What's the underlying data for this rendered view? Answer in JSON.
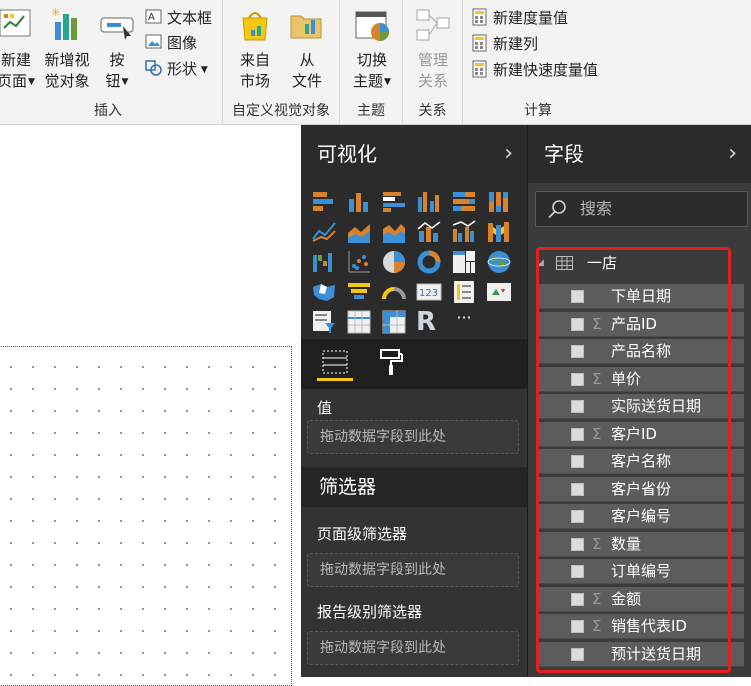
{
  "ribbon": {
    "insert": {
      "new_page": {
        "line1": "新建",
        "line2": "页面"
      },
      "new_visual": {
        "line1": "新增视",
        "line2": "觉对象"
      },
      "button": {
        "line1": "按",
        "line2": "钮"
      },
      "textbox": "文本框",
      "image": "图像",
      "shapes": "形状",
      "group_label": "插入"
    },
    "custom_visuals": {
      "from_market": {
        "line1": "来自",
        "line2": "市场"
      },
      "from_file": {
        "line1": "从",
        "line2": "文件"
      },
      "group_label": "自定义视觉对象"
    },
    "themes": {
      "switch_theme": {
        "line1": "切换",
        "line2": "主题"
      },
      "group_label": "主题"
    },
    "relationships": {
      "manage": {
        "line1": "管理",
        "line2": "关系"
      },
      "group_label": "关系"
    },
    "calculations": {
      "new_measure": "新建度量值",
      "new_column": "新建列",
      "new_quick_measure": "新建快速度量值",
      "group_label": "计算"
    }
  },
  "visualizations": {
    "title": "可视化",
    "more_label": "···",
    "r_label": "R",
    "kpi_text": "123",
    "values_well": {
      "title": "值",
      "placeholder": "拖动数据字段到此处"
    },
    "filters": {
      "title": "筛选器",
      "page_level": {
        "title": "页面级筛选器",
        "placeholder": "拖动数据字段到此处"
      },
      "report_level": {
        "title": "报告级别筛选器",
        "placeholder": "拖动数据字段到此处"
      }
    }
  },
  "fields": {
    "title": "字段",
    "search_placeholder": "搜索",
    "table_name": "一店",
    "items": [
      {
        "name": "下单日期",
        "sigma": ""
      },
      {
        "name": "产品ID",
        "sigma": "Σ"
      },
      {
        "name": "产品名称",
        "sigma": ""
      },
      {
        "name": "单价",
        "sigma": "Σ"
      },
      {
        "name": "实际送货日期",
        "sigma": ""
      },
      {
        "name": "客户ID",
        "sigma": "Σ"
      },
      {
        "name": "客户名称",
        "sigma": ""
      },
      {
        "name": "客户省份",
        "sigma": ""
      },
      {
        "name": "客户编号",
        "sigma": ""
      },
      {
        "name": "数量",
        "sigma": "Σ"
      },
      {
        "name": "订单编号",
        "sigma": ""
      },
      {
        "name": "金额",
        "sigma": "Σ"
      },
      {
        "name": "销售代表ID",
        "sigma": "Σ"
      },
      {
        "name": "预计送货日期",
        "sigma": ""
      }
    ]
  },
  "colors": {
    "accent_yellow": "#f2c811",
    "highlight_red": "#e02020",
    "pane_dark": "#2b2b2b",
    "field_row": "#5c5c5c"
  }
}
